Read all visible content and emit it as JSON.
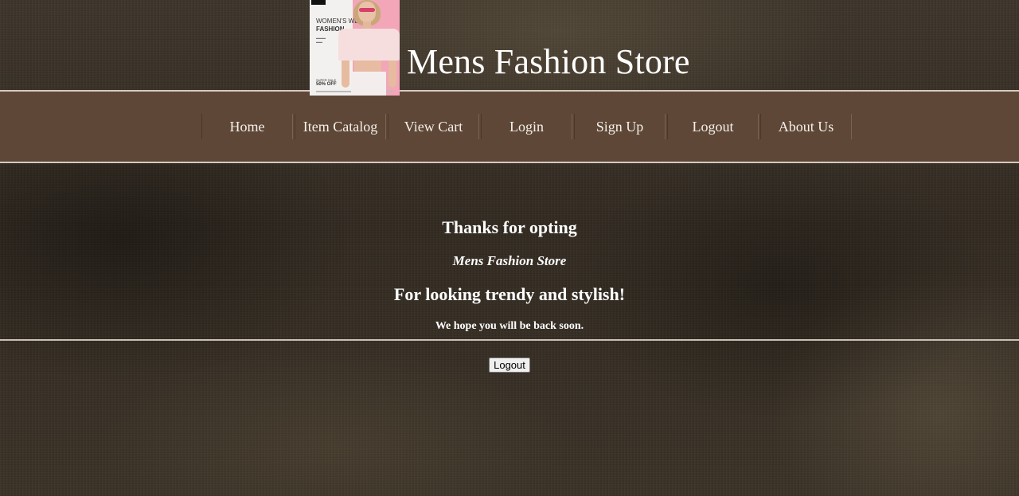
{
  "header": {
    "title": "Mens Fashion Store",
    "banner": {
      "line1": "WOMEN'S WEAR",
      "line2": "FASHION",
      "sale_label": "SUPER SALE",
      "sale_value": "50% OFF"
    }
  },
  "nav": {
    "items": [
      {
        "label": "Home"
      },
      {
        "label": "Item Catalog"
      },
      {
        "label": "View Cart"
      },
      {
        "label": "Login"
      },
      {
        "label": "Sign Up"
      },
      {
        "label": "Logout"
      },
      {
        "label": "About Us"
      }
    ]
  },
  "main": {
    "thanks": "Thanks for opting",
    "store_name": "Mens Fashion Store",
    "tagline": "For looking trendy and stylish!",
    "farewell": "We hope you will be back soon.",
    "logout_button": "Logout"
  },
  "colors": {
    "nav_background": "#5e4737",
    "page_background": "#3d3428",
    "text": "#ffffff"
  }
}
